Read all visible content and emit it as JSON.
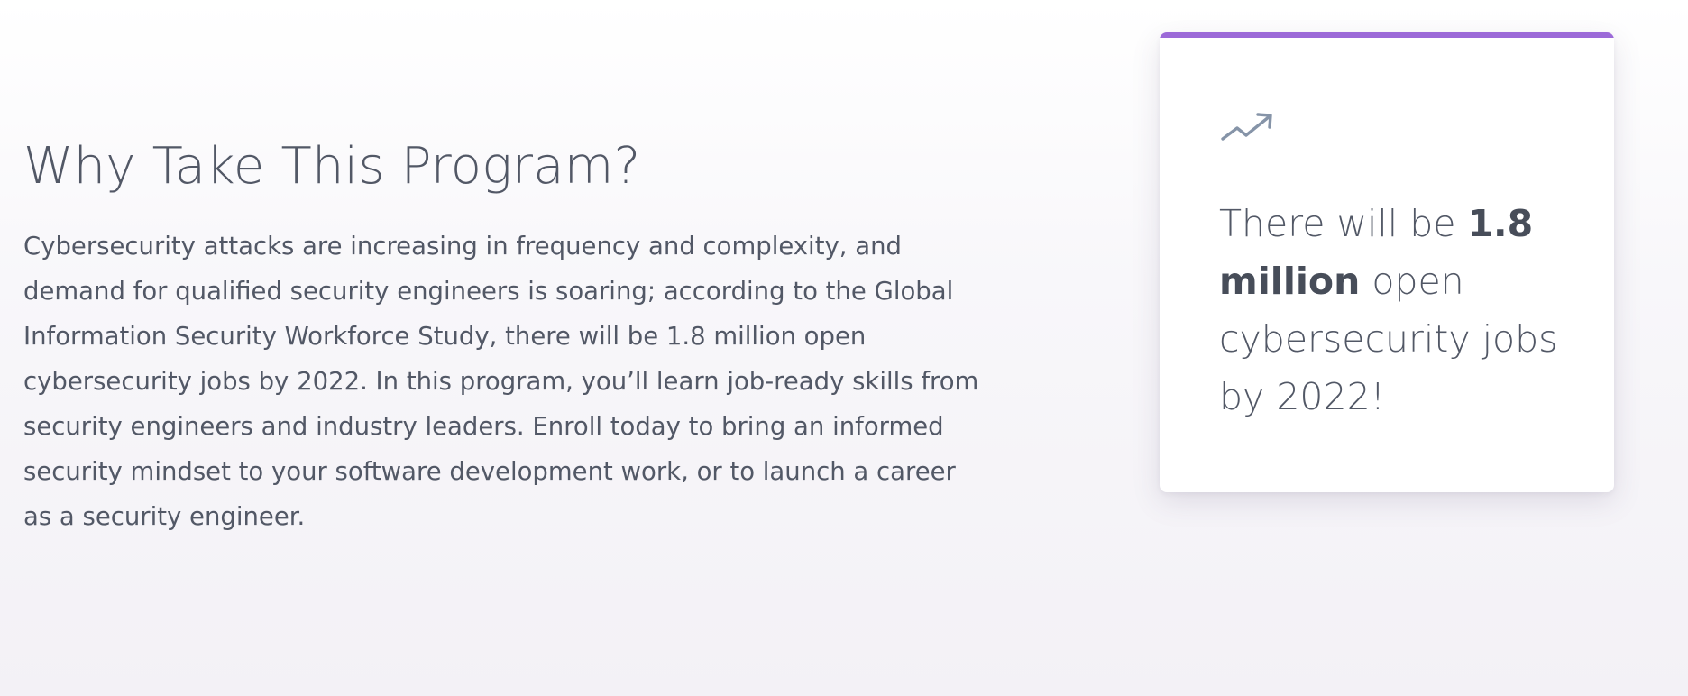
{
  "section": {
    "heading": "Why Take This Program?",
    "body": "Cybersecurity attacks are increasing in frequency and complexity, and demand for qualified security engineers is soaring; according to the Global Information Security Workforce Study, there will be 1.8 million open cybersecurity jobs by 2022. In this program, you’ll learn job-ready skills from security engineers and industry leaders. Enroll today to bring an informed security mindset to your software development work, or to launch a career as a security engineer."
  },
  "stat_card": {
    "icon": "trending-up-icon",
    "accent_color": "#9c6ad8",
    "text_before": "There will be ",
    "text_bold": "1.8 million",
    "text_after": " open cybersecurity jobs by 2022!"
  }
}
